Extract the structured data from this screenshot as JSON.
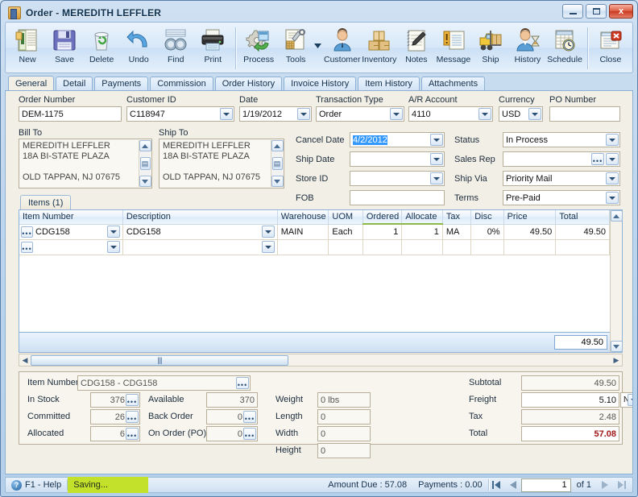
{
  "window": {
    "title": "Order - MEREDITH LEFFLER",
    "minimize_label": "Minimize",
    "maximize_label": "Maximize",
    "close_label": "x"
  },
  "toolbar": {
    "buttons": [
      {
        "label": "New",
        "icon": "new-document-icon"
      },
      {
        "label": "Save",
        "icon": "floppy-disk-icon"
      },
      {
        "label": "Delete",
        "icon": "recycle-bin-icon"
      },
      {
        "label": "Undo",
        "icon": "undo-arrow-icon"
      },
      {
        "label": "Find",
        "icon": "binoculars-icon"
      },
      {
        "label": "Print",
        "icon": "printer-icon"
      }
    ],
    "buttons2": [
      {
        "label": "Process",
        "icon": "gear-refresh-icon"
      },
      {
        "label": "Tools",
        "icon": "tools-icon"
      }
    ],
    "buttons3": [
      {
        "label": "Customer",
        "icon": "person-icon"
      },
      {
        "label": "Inventory",
        "icon": "boxes-icon"
      },
      {
        "label": "Notes",
        "icon": "notepad-pen-icon"
      },
      {
        "label": "Message",
        "icon": "message-icon"
      },
      {
        "label": "Ship",
        "icon": "forklift-icon"
      },
      {
        "label": "History",
        "icon": "person-hourglass-icon"
      },
      {
        "label": "Schedule",
        "icon": "schedule-clock-icon"
      }
    ],
    "buttons4": [
      {
        "label": "Close",
        "icon": "close-window-icon"
      }
    ]
  },
  "tabs": [
    {
      "label": "General",
      "active": true
    },
    {
      "label": "Detail",
      "active": false
    },
    {
      "label": "Payments",
      "active": false
    },
    {
      "label": "Commission",
      "active": false
    },
    {
      "label": "Order History",
      "active": false
    },
    {
      "label": "Invoice History",
      "active": false
    },
    {
      "label": "Item History",
      "active": false
    },
    {
      "label": "Attachments",
      "active": false
    }
  ],
  "header_fields": {
    "order_number": {
      "label": "Order Number",
      "value": "DEM-1175"
    },
    "customer_id": {
      "label": "Customer ID",
      "value": "C118947"
    },
    "date": {
      "label": "Date",
      "value": "1/19/2012"
    },
    "transaction_type": {
      "label": "Transaction Type",
      "value": "Order"
    },
    "ar_account": {
      "label": "A/R Account",
      "value": "4110"
    },
    "currency": {
      "label": "Currency",
      "value": "USD"
    },
    "po_number": {
      "label": "PO Number",
      "value": ""
    }
  },
  "bill_to": {
    "label": "Bill To",
    "lines": [
      "MEREDITH LEFFLER",
      "18A BI-STATE PLAZA",
      "",
      "OLD TAPPAN, NJ 07675"
    ]
  },
  "ship_to": {
    "label": "Ship To",
    "lines": [
      "MEREDITH LEFFLER",
      "18A BI-STATE PLAZA",
      "",
      "OLD TAPPAN, NJ 07675"
    ]
  },
  "left_fields": [
    {
      "label": "Cancel  Date",
      "value": "4/2/2012",
      "selected": true,
      "combo": true
    },
    {
      "label": "Ship Date",
      "value": "",
      "combo": true
    },
    {
      "label": "Store ID",
      "value": "",
      "combo": true
    },
    {
      "label": "FOB",
      "value": "",
      "combo": false
    }
  ],
  "right_fields": [
    {
      "label": "Status",
      "value": "In Process",
      "combo": true,
      "ellipsis": false
    },
    {
      "label": "Sales Rep",
      "value": "",
      "combo": true,
      "ellipsis": true
    },
    {
      "label": "Ship Via",
      "value": "Priority Mail",
      "combo": true,
      "ellipsis": false
    },
    {
      "label": "Terms",
      "value": "Pre-Paid",
      "combo": true,
      "ellipsis": false
    }
  ],
  "items_panel": {
    "subtab_label": "Items (1)",
    "columns": [
      "Item Number",
      "Description",
      "Warehouse",
      "UOM",
      "Ordered",
      "Allocate",
      "Tax",
      "Disc",
      "Price",
      "Total"
    ],
    "rows": [
      {
        "item_number": "CDG158",
        "description": "CDG158",
        "warehouse": "MAIN",
        "uom": "Each",
        "ordered": "1",
        "allocate": "1",
        "tax": "MA",
        "disc": "0%",
        "price": "49.50",
        "total": "49.50"
      },
      {
        "item_number": "",
        "description": "",
        "warehouse": "",
        "uom": "",
        "ordered": "",
        "allocate": "",
        "tax": "",
        "disc": "",
        "price": "",
        "total": ""
      }
    ],
    "footer_total": "49.50"
  },
  "item_detail": {
    "item_number": {
      "label": "Item Number",
      "value": "CDG158 - CDG158"
    },
    "in_stock": {
      "label": "In Stock",
      "value": "376"
    },
    "committed": {
      "label": "Committed",
      "value": "26"
    },
    "allocated": {
      "label": "Allocated",
      "value": "6"
    },
    "available": {
      "label": "Available",
      "value": "370"
    },
    "back_order": {
      "label": "Back Order",
      "value": "0"
    },
    "on_order_po": {
      "label": "On Order (PO)",
      "value": "0"
    },
    "weight": {
      "label": "Weight",
      "value": "0 lbs"
    },
    "length": {
      "label": "Length",
      "value": "0"
    },
    "width": {
      "label": "Width",
      "value": "0"
    },
    "height": {
      "label": "Height",
      "value": "0"
    }
  },
  "totals": {
    "subtotal": {
      "label": "Subtotal",
      "value": "49.50"
    },
    "freight": {
      "label": "Freight",
      "value": "5.10",
      "mode": "N"
    },
    "tax": {
      "label": "Tax",
      "value": "2.48"
    },
    "total": {
      "label": "Total",
      "value": "57.08"
    }
  },
  "statusbar": {
    "help": "F1 - Help",
    "saving": "Saving...",
    "amount_due": "Amount Due : 57.08",
    "payments": "Payments : 0.00",
    "page_value": "1",
    "page_of": "of 1",
    "first_label": "First",
    "prev_label": "Previous",
    "next_label": "Next",
    "last_label": "Last"
  },
  "colors": {
    "accent": "#cfe0f2",
    "client_bg": "#f2efe6",
    "highlight_cell": "#ffff00",
    "total_red": "#a01717",
    "saving_green": "#c3e02a",
    "selection_blue": "#3399ff"
  }
}
